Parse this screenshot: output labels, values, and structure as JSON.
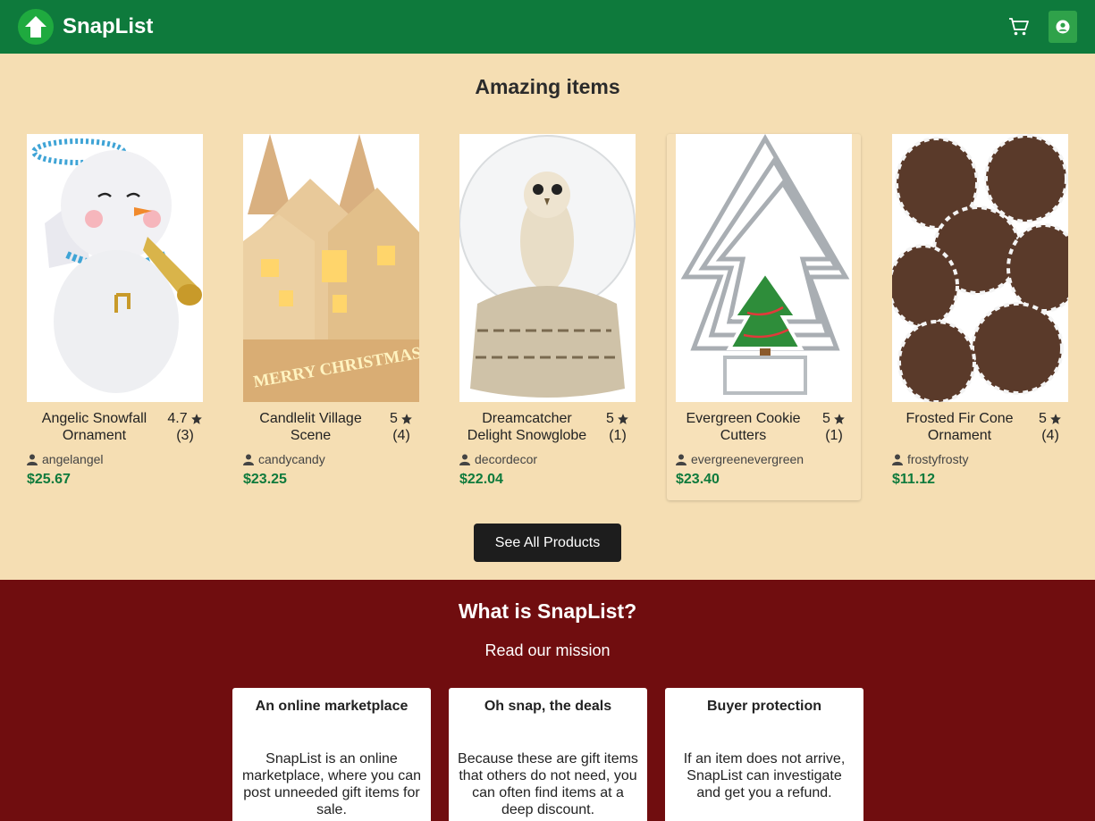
{
  "header": {
    "brand": "SnapList",
    "colors": {
      "bar": "#0e7a3c",
      "logo": "#1faa3f",
      "account": "#2fa24a"
    },
    "icons": [
      "up-arrow-logo-icon",
      "cart-icon",
      "user-icon"
    ]
  },
  "featured": {
    "title": "Amazing items",
    "see_all_label": "See All Products",
    "price_color": "#0e7a3c",
    "products": [
      {
        "name": "Angelic Snowfall Ornament",
        "rating": "4.7",
        "count": "(3)",
        "seller": "angelangel",
        "price": "$25.67"
      },
      {
        "name": "Candlelit Village Scene",
        "rating": "5",
        "count": "(4)",
        "seller": "candycandy",
        "price": "$23.25"
      },
      {
        "name": "Dreamcatcher Delight Snowglobe",
        "rating": "5",
        "count": "(1)",
        "seller": "decordecor",
        "price": "$22.04"
      },
      {
        "name": "Evergreen Cookie Cutters",
        "rating": "5",
        "count": "(1)",
        "seller": "evergreenevergreen",
        "price": "$23.40"
      },
      {
        "name": "Frosted Fir Cone Ornament",
        "rating": "5",
        "count": "(4)",
        "seller": "frostyfrosty",
        "price": "$11.12"
      }
    ],
    "image_text": {
      "village_sign": "MERRY CHRISTMAS"
    }
  },
  "about": {
    "title": "What is SnapList?",
    "mission_link": "Read our mission",
    "background": "#700d0f",
    "cards": [
      {
        "title": "An online marketplace",
        "text": "SnapList is an online marketplace, where you can post unneeded gift items for sale."
      },
      {
        "title": "Oh snap, the deals",
        "text": "Because these are gift items that others do not need, you can often find items at a deep discount."
      },
      {
        "title": "Buyer protection",
        "text": "If an item does not arrive, SnapList can investigate and get you a refund."
      }
    ]
  }
}
